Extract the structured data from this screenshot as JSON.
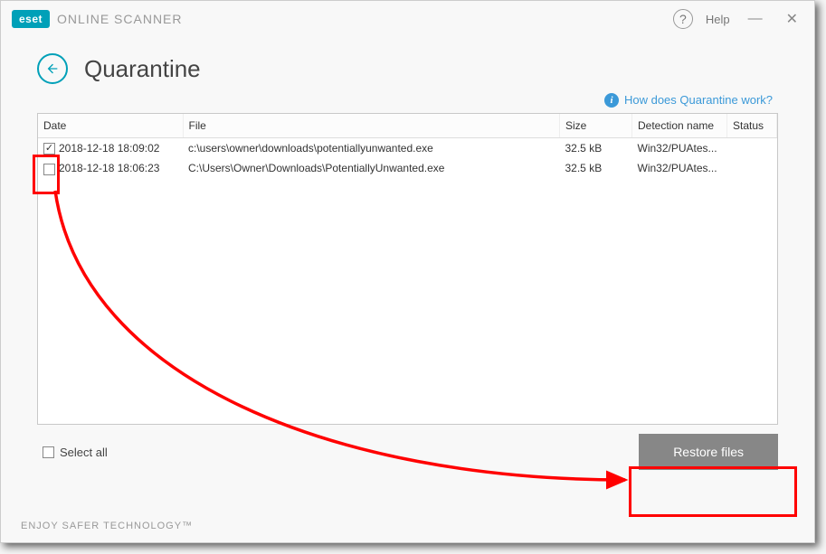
{
  "brand": {
    "badge": "eset",
    "product": "ONLINE SCANNER",
    "footer": "ENJOY SAFER TECHNOLOGY™"
  },
  "titlebar": {
    "help_label": "Help"
  },
  "page": {
    "title": "Quarantine",
    "help_link": "How does Quarantine work?"
  },
  "table": {
    "headers": {
      "date": "Date",
      "file": "File",
      "size": "Size",
      "detection": "Detection name",
      "status": "Status"
    },
    "rows": [
      {
        "checked": true,
        "date": "2018-12-18 18:09:02",
        "file": "c:\\users\\owner\\downloads\\potentiallyunwanted.exe",
        "size": "32.5 kB",
        "detection": "Win32/PUAtes...",
        "status": ""
      },
      {
        "checked": false,
        "date": "2018-12-18 18:06:23",
        "file": "C:\\Users\\Owner\\Downloads\\PotentiallyUnwanted.exe",
        "size": "32.5 kB",
        "detection": "Win32/PUAtes...",
        "status": ""
      }
    ]
  },
  "actions": {
    "select_all": "Select all",
    "restore": "Restore files"
  }
}
